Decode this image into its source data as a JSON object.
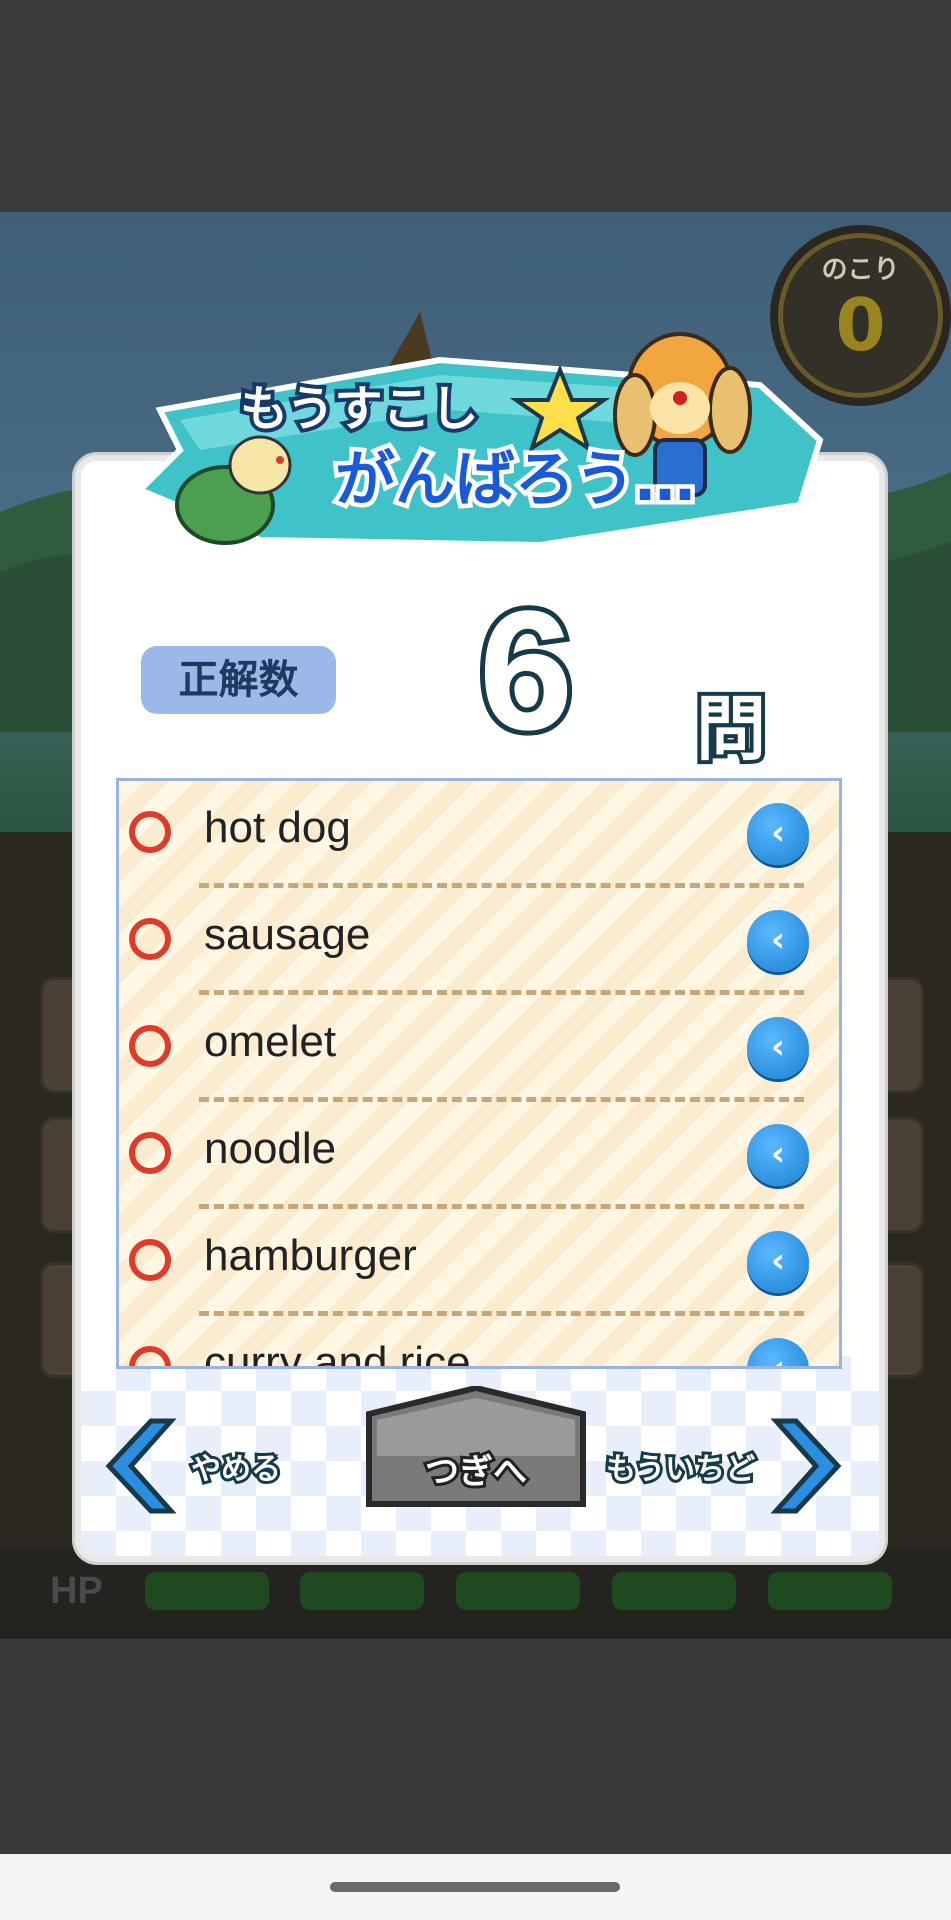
{
  "game": {
    "remaining_label": "のこり",
    "remaining_value": "0",
    "hp_label": "HP",
    "hp_segments": 5
  },
  "result": {
    "banner_line1": "もうすこし",
    "banner_line2": "がんばろう…",
    "score_label": "正解数",
    "score_value": "6",
    "score_unit": "問"
  },
  "words": [
    {
      "text": "hot dog",
      "correct": true
    },
    {
      "text": "sausage",
      "correct": true
    },
    {
      "text": "omelet",
      "correct": true
    },
    {
      "text": "noodle",
      "correct": true
    },
    {
      "text": "hamburger",
      "correct": true
    },
    {
      "text": "curry and rice",
      "correct": true
    }
  ],
  "play_icon": "play-audio-icon",
  "buttons": {
    "quit": "やめる",
    "next": "つぎへ",
    "retry": "もういちど"
  },
  "colors": {
    "accent_blue": "#1a80d0",
    "correct_mark": "#e03a2a",
    "banner_teal": "#3fc3c8",
    "title_navy": "#173a4a"
  }
}
